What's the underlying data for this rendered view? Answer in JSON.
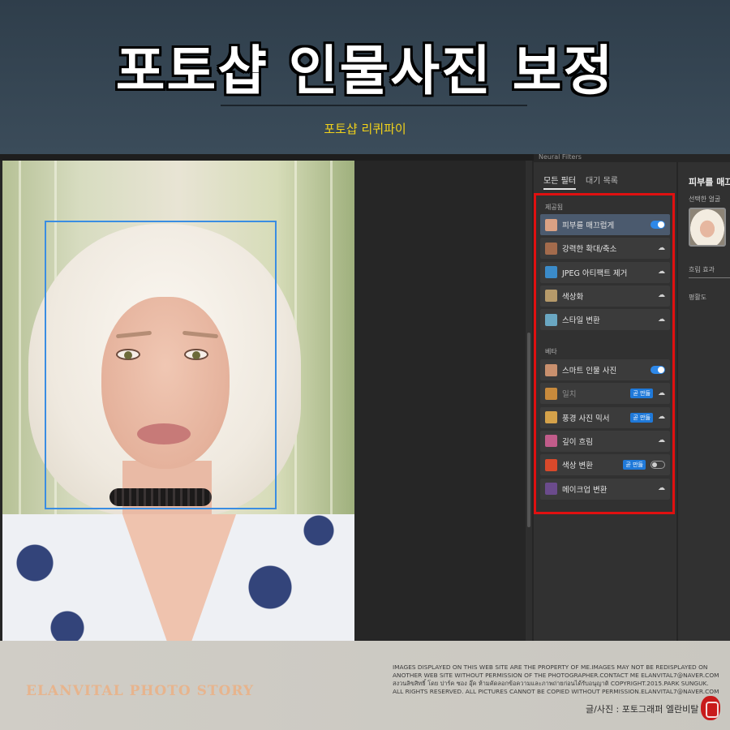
{
  "banner": {
    "title": "포토샵 인물사진 보정",
    "subtitle": "포토샵 리퀴파이"
  },
  "panel": {
    "header": "Neural Filters",
    "tabs": [
      {
        "label": "모든 필터",
        "active": true
      },
      {
        "label": "대기 목록",
        "active": false
      }
    ],
    "group_featured": "제공됨",
    "group_beta": "베타",
    "featured": [
      {
        "label": "피부를 매끄럽게",
        "control": "toggle-on",
        "selected": true,
        "thumb_color": "#d9a184"
      },
      {
        "label": "강력한 확대/축소",
        "control": "cloud",
        "thumb_color": "#a36b4c"
      },
      {
        "label": "JPEG 아티팩트 제거",
        "control": "cloud",
        "thumb_color": "#3b8bc9"
      },
      {
        "label": "색상화",
        "control": "cloud",
        "thumb_color": "#b69a6a"
      },
      {
        "label": "스타일 변환",
        "control": "cloud",
        "thumb_color": "#6aa7c2"
      }
    ],
    "beta": [
      {
        "label": "스마트 인물 사진",
        "control": "toggle-on",
        "thumb_color": "#c9906e"
      },
      {
        "label": "일치",
        "control": "cloud",
        "badge": "곧 만듦",
        "dim": true,
        "thumb_color": "#c88a3c"
      },
      {
        "label": "풍경 사진 믹서",
        "control": "cloud",
        "badge": "곧 만듦",
        "thumb_color": "#d5a24a"
      },
      {
        "label": "깊이 흐림",
        "control": "cloud",
        "thumb_color": "#c15c8a"
      },
      {
        "label": "색상 변환",
        "control": "toggle-off",
        "badge": "곧 만듦",
        "thumb_color": "#d9492b"
      },
      {
        "label": "메이크업 변환",
        "control": "cloud",
        "thumb_color": "#6b4b8c"
      }
    ],
    "detail": {
      "title": "피부를 매끄",
      "selected_face_label": "선택한 얼굴",
      "blur_label": "흐림 효과",
      "smoothness_label": "평활도"
    }
  },
  "footer": {
    "brand": "ELANVITAL PHOTO  STORY",
    "legal": [
      "IMAGES DISPLAYED ON THIS WEB SITE ARE THE PROPERTY OF ME.IMAGES MAY NOT BE REDISPLAYED ON",
      "ANOTHER WEB SITE WITHOUT PERMISSION OF THE  PHOTOGRAPHER.CONTACT ME ELANVITAL7@NAVER.COM",
      "สงวนลิขสิทธิ์ โดย ปาร์ค ซอง อุ๊ค  ห้ามคัดลอกข้อความและภาพถ่ายก่อนได้รับอนุญาติ COPYRIGHT.2015.PARK SUNGUK.",
      "ALL RIGHTS RESERVED. ALL PICTURES CANNOT BE COPIED WITHOUT PERMISSION.ELANVITAL7@NAVER.COM"
    ],
    "credit": "글/사진 : 포토그래퍼 엘란비탈"
  }
}
